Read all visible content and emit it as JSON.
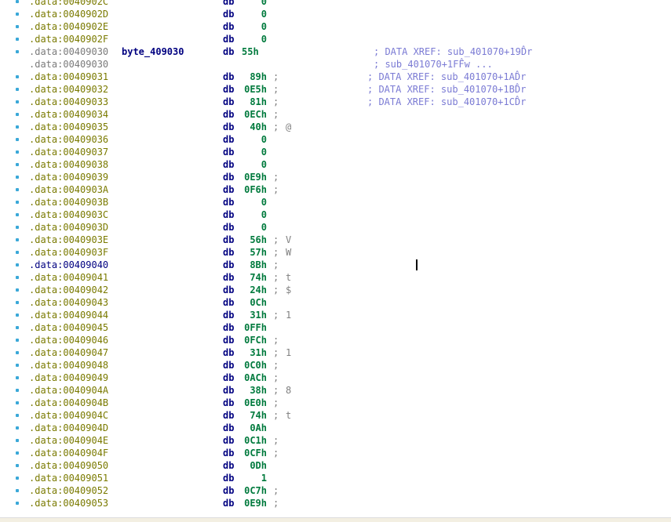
{
  "listing": {
    "rows": [
      {
        "addr": ".data:0040902C",
        "mnem": "db",
        "val": "0",
        "semi": "",
        "chr": "",
        "label": "",
        "xref": "",
        "style": "normal"
      },
      {
        "addr": ".data:0040902D",
        "mnem": "db",
        "val": "0",
        "semi": "",
        "chr": "",
        "label": "",
        "xref": "",
        "style": "normal"
      },
      {
        "addr": ".data:0040902E",
        "mnem": "db",
        "val": "0",
        "semi": "",
        "chr": "",
        "label": "",
        "xref": "",
        "style": "normal"
      },
      {
        "addr": ".data:0040902F",
        "mnem": "db",
        "val": "0",
        "semi": "",
        "chr": "",
        "label": "",
        "xref": "",
        "style": "normal"
      },
      {
        "addr": ".data:00409030",
        "mnem": "db",
        "val": "55h",
        "semi": "",
        "chr": "",
        "label": "byte_409030",
        "xref": "; DATA XREF: sub_401070+19D̂r",
        "style": "named"
      },
      {
        "addr": ".data:00409030",
        "mnem": "",
        "val": "",
        "semi": "",
        "chr": "",
        "label": "",
        "xref": "; sub_401070+1FF̂w ...",
        "style": "named"
      },
      {
        "addr": ".data:00409031",
        "mnem": "db",
        "val": "89h",
        "semi": ";",
        "chr": "",
        "label": "",
        "xref": "; DATA XREF: sub_401070+1AD̂r",
        "style": "normal"
      },
      {
        "addr": ".data:00409032",
        "mnem": "db",
        "val": "0E5h",
        "semi": ";",
        "chr": "",
        "label": "",
        "xref": "; DATA XREF: sub_401070+1BD̂r",
        "style": "normal"
      },
      {
        "addr": ".data:00409033",
        "mnem": "db",
        "val": "81h",
        "semi": ";",
        "chr": "",
        "label": "",
        "xref": "; DATA XREF: sub_401070+1CD̂r",
        "style": "normal"
      },
      {
        "addr": ".data:00409034",
        "mnem": "db",
        "val": "0ECh",
        "semi": ";",
        "chr": "",
        "label": "",
        "xref": "",
        "style": "normal"
      },
      {
        "addr": ".data:00409035",
        "mnem": "db",
        "val": "40h",
        "semi": ";",
        "chr": "@",
        "label": "",
        "xref": "",
        "style": "normal"
      },
      {
        "addr": ".data:00409036",
        "mnem": "db",
        "val": "0",
        "semi": "",
        "chr": "",
        "label": "",
        "xref": "",
        "style": "normal"
      },
      {
        "addr": ".data:00409037",
        "mnem": "db",
        "val": "0",
        "semi": "",
        "chr": "",
        "label": "",
        "xref": "",
        "style": "normal"
      },
      {
        "addr": ".data:00409038",
        "mnem": "db",
        "val": "0",
        "semi": "",
        "chr": "",
        "label": "",
        "xref": "",
        "style": "normal"
      },
      {
        "addr": ".data:00409039",
        "mnem": "db",
        "val": "0E9h",
        "semi": ";",
        "chr": "",
        "label": "",
        "xref": "",
        "style": "normal"
      },
      {
        "addr": ".data:0040903A",
        "mnem": "db",
        "val": "0F6h",
        "semi": ";",
        "chr": "",
        "label": "",
        "xref": "",
        "style": "normal"
      },
      {
        "addr": ".data:0040903B",
        "mnem": "db",
        "val": "0",
        "semi": "",
        "chr": "",
        "label": "",
        "xref": "",
        "style": "normal"
      },
      {
        "addr": ".data:0040903C",
        "mnem": "db",
        "val": "0",
        "semi": "",
        "chr": "",
        "label": "",
        "xref": "",
        "style": "normal"
      },
      {
        "addr": ".data:0040903D",
        "mnem": "db",
        "val": "0",
        "semi": "",
        "chr": "",
        "label": "",
        "xref": "",
        "style": "normal"
      },
      {
        "addr": ".data:0040903E",
        "mnem": "db",
        "val": "56h",
        "semi": ";",
        "chr": "V",
        "label": "",
        "xref": "",
        "style": "normal"
      },
      {
        "addr": ".data:0040903F",
        "mnem": "db",
        "val": "57h",
        "semi": ";",
        "chr": "W",
        "label": "",
        "xref": "",
        "style": "normal"
      },
      {
        "addr": ".data:00409040",
        "mnem": "db",
        "val": "8Bh",
        "semi": ";",
        "chr": "",
        "label": "",
        "xref": "",
        "style": "current"
      },
      {
        "addr": ".data:00409041",
        "mnem": "db",
        "val": "74h",
        "semi": ";",
        "chr": "t",
        "label": "",
        "xref": "",
        "style": "normal"
      },
      {
        "addr": ".data:00409042",
        "mnem": "db",
        "val": "24h",
        "semi": ";",
        "chr": "$",
        "label": "",
        "xref": "",
        "style": "normal"
      },
      {
        "addr": ".data:00409043",
        "mnem": "db",
        "val": "0Ch",
        "semi": "",
        "chr": "",
        "label": "",
        "xref": "",
        "style": "normal"
      },
      {
        "addr": ".data:00409044",
        "mnem": "db",
        "val": "31h",
        "semi": ";",
        "chr": "1",
        "label": "",
        "xref": "",
        "style": "normal"
      },
      {
        "addr": ".data:00409045",
        "mnem": "db",
        "val": "0FFh",
        "semi": "",
        "chr": "",
        "label": "",
        "xref": "",
        "style": "normal"
      },
      {
        "addr": ".data:00409046",
        "mnem": "db",
        "val": "0FCh",
        "semi": ";",
        "chr": "",
        "label": "",
        "xref": "",
        "style": "normal"
      },
      {
        "addr": ".data:00409047",
        "mnem": "db",
        "val": "31h",
        "semi": ";",
        "chr": "1",
        "label": "",
        "xref": "",
        "style": "normal"
      },
      {
        "addr": ".data:00409048",
        "mnem": "db",
        "val": "0C0h",
        "semi": ";",
        "chr": "",
        "label": "",
        "xref": "",
        "style": "normal"
      },
      {
        "addr": ".data:00409049",
        "mnem": "db",
        "val": "0ACh",
        "semi": ";",
        "chr": "",
        "label": "",
        "xref": "",
        "style": "normal"
      },
      {
        "addr": ".data:0040904A",
        "mnem": "db",
        "val": "38h",
        "semi": ";",
        "chr": "8",
        "label": "",
        "xref": "",
        "style": "normal"
      },
      {
        "addr": ".data:0040904B",
        "mnem": "db",
        "val": "0E0h",
        "semi": ";",
        "chr": "",
        "label": "",
        "xref": "",
        "style": "normal"
      },
      {
        "addr": ".data:0040904C",
        "mnem": "db",
        "val": "74h",
        "semi": ";",
        "chr": "t",
        "label": "",
        "xref": "",
        "style": "normal"
      },
      {
        "addr": ".data:0040904D",
        "mnem": "db",
        "val": "0Ah",
        "semi": "",
        "chr": "",
        "label": "",
        "xref": "",
        "style": "normal"
      },
      {
        "addr": ".data:0040904E",
        "mnem": "db",
        "val": "0C1h",
        "semi": ";",
        "chr": "",
        "label": "",
        "xref": "",
        "style": "normal"
      },
      {
        "addr": ".data:0040904F",
        "mnem": "db",
        "val": "0CFh",
        "semi": ";",
        "chr": "",
        "label": "",
        "xref": "",
        "style": "normal"
      },
      {
        "addr": ".data:00409050",
        "mnem": "db",
        "val": "0Dh",
        "semi": "",
        "chr": "",
        "label": "",
        "xref": "",
        "style": "normal"
      },
      {
        "addr": ".data:00409051",
        "mnem": "db",
        "val": "1",
        "semi": "",
        "chr": "",
        "label": "",
        "xref": "",
        "style": "normal"
      },
      {
        "addr": ".data:00409052",
        "mnem": "db",
        "val": "0C7h",
        "semi": ";",
        "chr": "",
        "label": "",
        "xref": "",
        "style": "normal"
      },
      {
        "addr": ".data:00409053",
        "mnem": "db",
        "val": "0E9h",
        "semi": ";",
        "chr": "",
        "label": "",
        "xref": "",
        "style": "normal"
      }
    ]
  }
}
